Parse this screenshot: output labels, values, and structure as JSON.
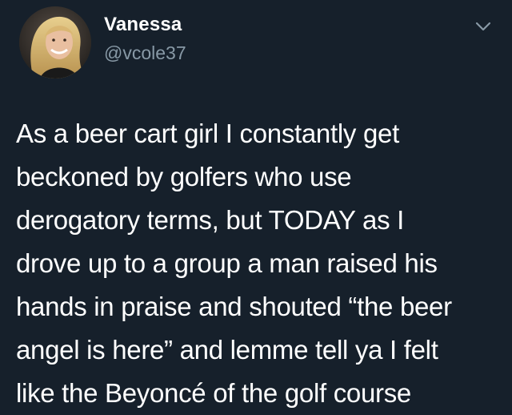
{
  "author": {
    "display_name": "Vanessa",
    "handle": "@vcole37"
  },
  "menu_icon": "chevron-down-icon",
  "tweet": {
    "lines": [
      "As a beer cart girl I constantly get",
      "beckoned by golfers who use",
      "derogatory terms, but TODAY as I",
      "drove up to a group a man raised his",
      "hands in praise and shouted “the beer",
      "angel is here” and lemme tell ya I felt",
      "like the Beyoncé of the golf course"
    ]
  },
  "colors": {
    "background": "#16202b",
    "text": "#ffffff",
    "secondary_text": "#8899a6"
  }
}
